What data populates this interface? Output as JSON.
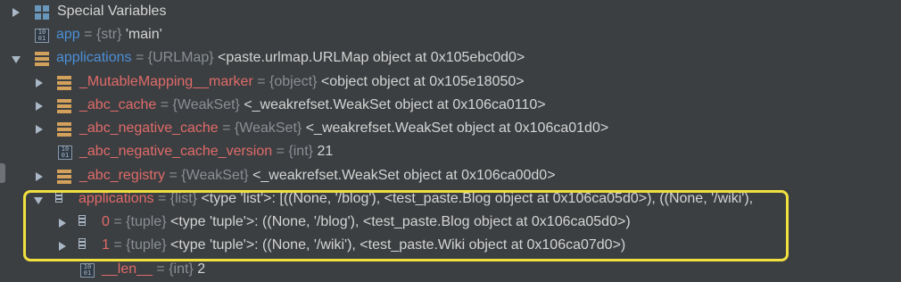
{
  "tree": {
    "special": {
      "name": "Special Variables"
    },
    "app": {
      "name": "app",
      "type": "= {str}",
      "value": "'main'"
    },
    "applications": {
      "name": "applications",
      "type": "= {URLMap}",
      "value": "<paste.urlmap.URLMap object at 0x105ebc0d0>"
    },
    "marker": {
      "name": "_MutableMapping__marker",
      "type": "= {object}",
      "value": "<object object at 0x105e18050>"
    },
    "abc_cache": {
      "name": "_abc_cache",
      "type": "= {WeakSet}",
      "value": "<_weakrefset.WeakSet object at 0x106ca0110>"
    },
    "abc_negative_cache": {
      "name": "_abc_negative_cache",
      "type": "= {WeakSet}",
      "value": "<_weakrefset.WeakSet object at 0x106ca01d0>"
    },
    "abc_negative_cache_version": {
      "name": "_abc_negative_cache_version",
      "type": "= {int}",
      "value": "21"
    },
    "abc_registry": {
      "name": "_abc_registry",
      "type": "= {WeakSet}",
      "value": "<_weakrefset.WeakSet object at 0x106ca00d0>"
    },
    "applications_list": {
      "name": "applications",
      "type": "= {list}",
      "value": "<type 'list'>: [((None, '/blog'), <test_paste.Blog object at 0x106ca05d0>), ((None, '/wiki'),",
      "icon_digits": "0 1"
    },
    "item0": {
      "name": "0",
      "type": "= {tuple}",
      "value": "<type 'tuple'>: ((None, '/blog'), <test_paste.Blog object at 0x106ca05d0>)",
      "icon_digits": "0 1"
    },
    "item1": {
      "name": "1",
      "type": "= {tuple}",
      "value": "<type 'tuple'>: ((None, '/wiki'), <test_paste.Wiki object at 0x106ca07d0>)",
      "icon_digits": "0 1"
    },
    "len": {
      "name": "__len__",
      "type": "= {int}",
      "value": "2"
    }
  },
  "icons": {
    "special": "grid-icon",
    "primitive": "binary-icon",
    "object": "object-stack-icon",
    "list": "list-icon"
  },
  "colors": {
    "background": "#3c3f41",
    "name_blue": "#4a8fd8",
    "name_red": "#e06a6a",
    "type_gray": "#8a8f94",
    "highlight": "#f0e040"
  }
}
